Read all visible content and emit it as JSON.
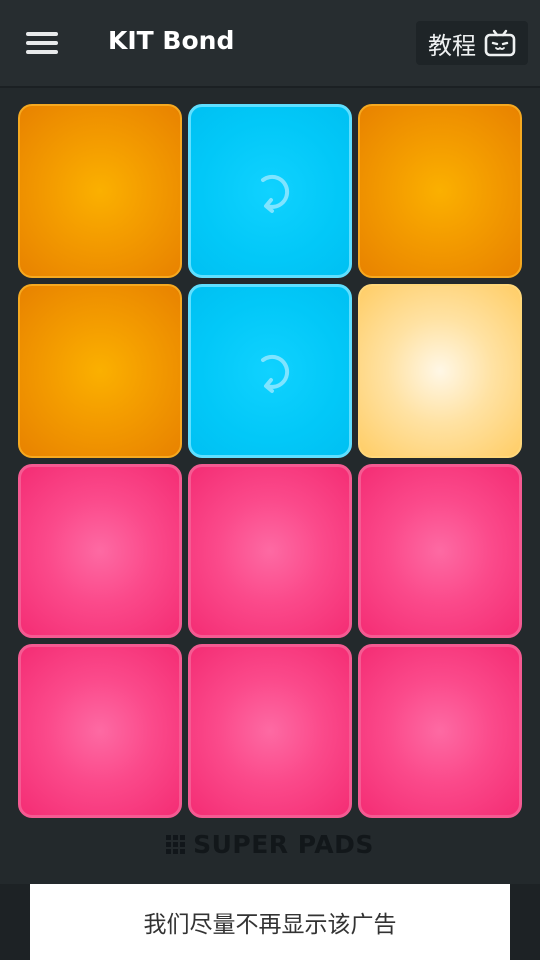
{
  "header": {
    "title": "KIT Bond",
    "tutorial_label": "教程",
    "tutorial_icon": "tv-icon",
    "menu_icon": "hamburger-menu-icon"
  },
  "pads": [
    {
      "color": "orange",
      "loop": false
    },
    {
      "color": "blue",
      "loop": true
    },
    {
      "color": "orange",
      "loop": false
    },
    {
      "color": "orange",
      "loop": false
    },
    {
      "color": "blue",
      "loop": true
    },
    {
      "color": "lit",
      "loop": false
    },
    {
      "color": "pink",
      "loop": false
    },
    {
      "color": "pink",
      "loop": false
    },
    {
      "color": "pink",
      "loop": false
    },
    {
      "color": "pink",
      "loop": false
    },
    {
      "color": "pink",
      "loop": false
    },
    {
      "color": "pink",
      "loop": false
    }
  ],
  "brand": {
    "text": "SUPER PADS"
  },
  "ad": {
    "text": "我们尽量不再显示该广告"
  },
  "colors": {
    "background": "#23292c",
    "orange": "#f49d00",
    "blue": "#02c8f8",
    "lit": "#ffe2a3",
    "pink": "#fb4a8b"
  }
}
